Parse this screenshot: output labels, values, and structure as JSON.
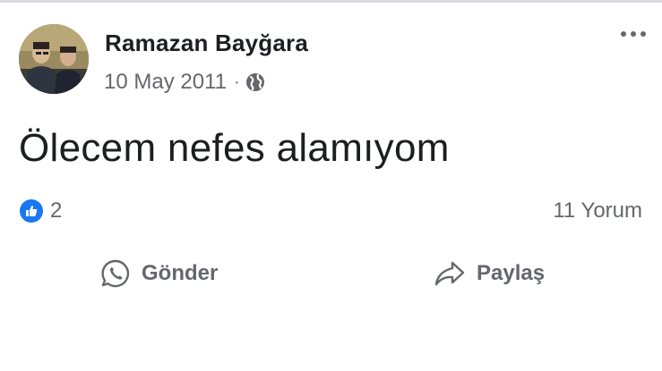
{
  "post": {
    "author": "Ramazan Bayğara",
    "date": "10 May 2011",
    "separator": "·",
    "privacy_icon": "globe-icon",
    "text": "Ölecem nefes alamıyom",
    "reaction_icon": "like-icon",
    "reaction_count": "2",
    "comment_count_label": "11 Yorum"
  },
  "actions": {
    "send_label": "Gönder",
    "send_icon": "whatsapp-icon",
    "share_label": "Paylaş",
    "share_icon": "share-arrow-icon"
  },
  "colors": {
    "text_primary": "#1c1e21",
    "text_secondary": "#65676b",
    "like_blue": "#1877f2"
  }
}
